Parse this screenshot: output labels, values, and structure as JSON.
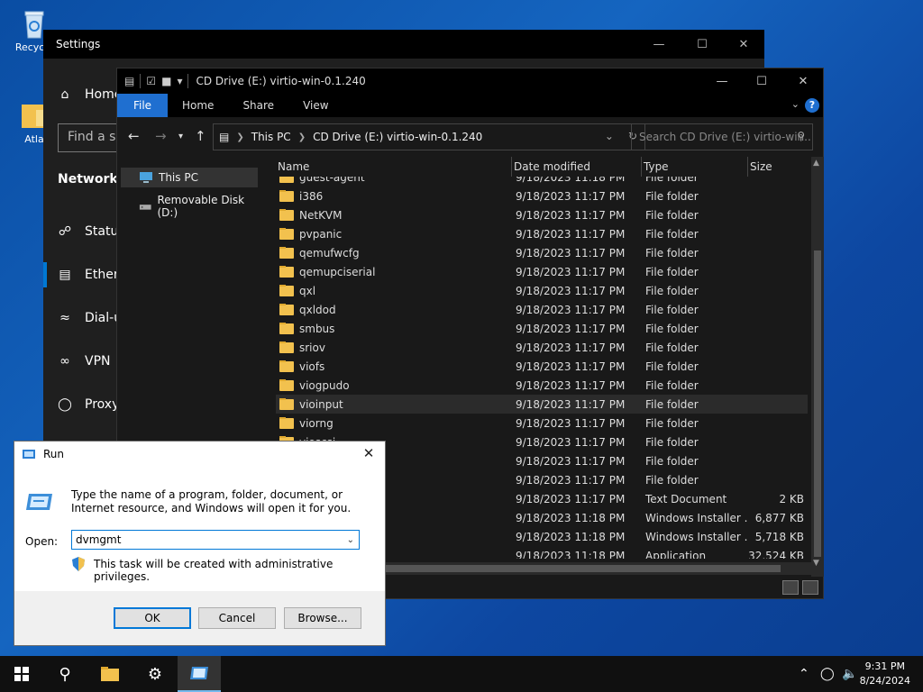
{
  "desktop": {
    "icons": [
      {
        "label": "Recycle"
      },
      {
        "label": "Atla"
      }
    ]
  },
  "settings": {
    "title": "Settings",
    "home_label": "Home",
    "find_placeholder": "Find a se",
    "section_title": "Network 8",
    "nav": [
      {
        "label": "Status"
      },
      {
        "label": "Ethern"
      },
      {
        "label": "Dial-u"
      },
      {
        "label": "VPN"
      },
      {
        "label": "Proxy"
      }
    ]
  },
  "explorer": {
    "title": "CD Drive (E:) virtio-win-0.1.240",
    "ribbon_tabs": [
      "File",
      "Home",
      "Share",
      "View"
    ],
    "address": {
      "crumbs": [
        "This PC",
        "CD Drive (E:) virtio-win-0.1.240"
      ]
    },
    "search_placeholder": "Search CD Drive (E:) virtio-win...",
    "nav_pane": [
      {
        "label": "This PC"
      },
      {
        "label": "Removable Disk (D:)"
      }
    ],
    "columns": [
      "Name",
      "Date modified",
      "Type",
      "Size"
    ],
    "rows": [
      {
        "name": "guest-agent",
        "date": "9/18/2023 11:18 PM",
        "type": "File folder",
        "size": "",
        "kind": "folder"
      },
      {
        "name": "i386",
        "date": "9/18/2023 11:17 PM",
        "type": "File folder",
        "size": "",
        "kind": "folder"
      },
      {
        "name": "NetKVM",
        "date": "9/18/2023 11:17 PM",
        "type": "File folder",
        "size": "",
        "kind": "folder"
      },
      {
        "name": "pvpanic",
        "date": "9/18/2023 11:17 PM",
        "type": "File folder",
        "size": "",
        "kind": "folder"
      },
      {
        "name": "qemufwcfg",
        "date": "9/18/2023 11:17 PM",
        "type": "File folder",
        "size": "",
        "kind": "folder"
      },
      {
        "name": "qemupciserial",
        "date": "9/18/2023 11:17 PM",
        "type": "File folder",
        "size": "",
        "kind": "folder"
      },
      {
        "name": "qxl",
        "date": "9/18/2023 11:17 PM",
        "type": "File folder",
        "size": "",
        "kind": "folder"
      },
      {
        "name": "qxldod",
        "date": "9/18/2023 11:17 PM",
        "type": "File folder",
        "size": "",
        "kind": "folder"
      },
      {
        "name": "smbus",
        "date": "9/18/2023 11:17 PM",
        "type": "File folder",
        "size": "",
        "kind": "folder"
      },
      {
        "name": "sriov",
        "date": "9/18/2023 11:17 PM",
        "type": "File folder",
        "size": "",
        "kind": "folder"
      },
      {
        "name": "viofs",
        "date": "9/18/2023 11:17 PM",
        "type": "File folder",
        "size": "",
        "kind": "folder"
      },
      {
        "name": "viogpudo",
        "date": "9/18/2023 11:17 PM",
        "type": "File folder",
        "size": "",
        "kind": "folder"
      },
      {
        "name": "vioinput",
        "date": "9/18/2023 11:17 PM",
        "type": "File folder",
        "size": "",
        "kind": "folder"
      },
      {
        "name": "viorng",
        "date": "9/18/2023 11:17 PM",
        "type": "File folder",
        "size": "",
        "kind": "folder"
      },
      {
        "name": "vioscsi",
        "date": "9/18/2023 11:17 PM",
        "type": "File folder",
        "size": "",
        "kind": "folder"
      },
      {
        "name": "",
        "date": "9/18/2023 11:17 PM",
        "type": "File folder",
        "size": "",
        "kind": "none"
      },
      {
        "name": "",
        "date": "9/18/2023 11:17 PM",
        "type": "File folder",
        "size": "",
        "kind": "none"
      },
      {
        "name": "xt",
        "date": "9/18/2023 11:17 PM",
        "type": "Text Document",
        "size": "2 KB",
        "kind": "none"
      },
      {
        "name": "nsi",
        "date": "9/18/2023 11:18 PM",
        "type": "Windows Installer ...",
        "size": "6,877 KB",
        "kind": "none"
      },
      {
        "name": "nsi",
        "date": "9/18/2023 11:18 PM",
        "type": "Windows Installer ...",
        "size": "5,718 KB",
        "kind": "none"
      },
      {
        "name": "ools.exe",
        "date": "9/18/2023 11:18 PM",
        "type": "Application",
        "size": "32,524 KB",
        "kind": "none"
      }
    ]
  },
  "run": {
    "title": "Run",
    "description": "Type the name of a program, folder, document, or Internet resource, and Windows will open it for you.",
    "open_label": "Open:",
    "open_value": "dvmgmt",
    "privilege_note": "This task will be created with administrative privileges.",
    "ok_label": "OK",
    "cancel_label": "Cancel",
    "browse_label": "Browse..."
  },
  "taskbar": {
    "time": "9:31 PM",
    "date": "8/24/2024"
  }
}
